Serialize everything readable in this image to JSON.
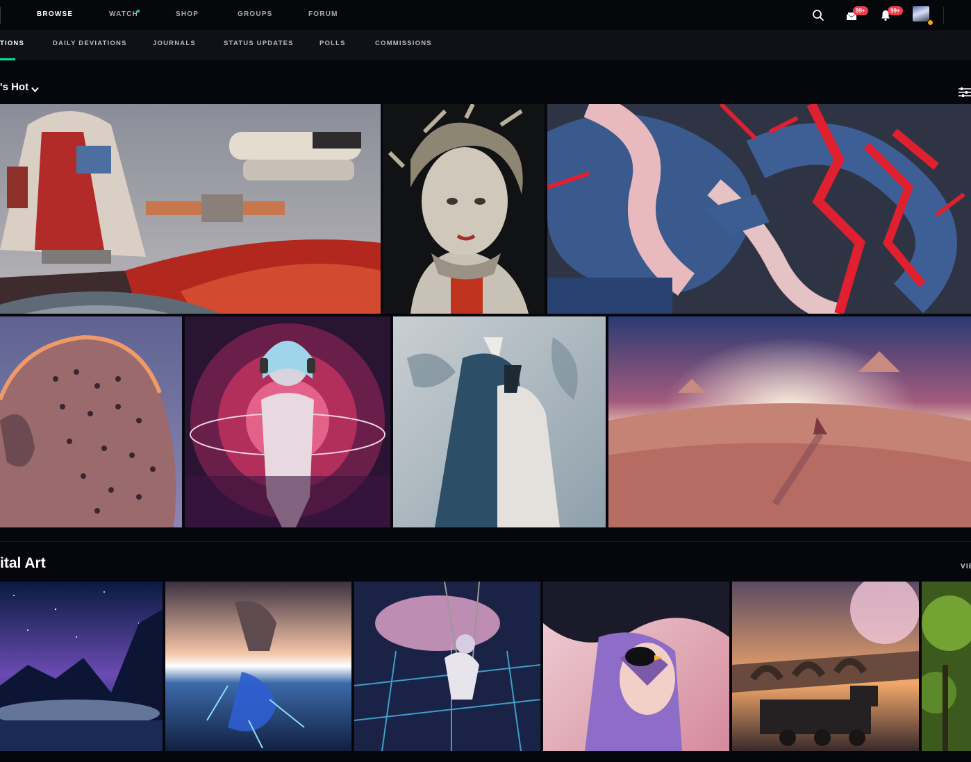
{
  "nav": {
    "items": [
      "BROWSE",
      "WATCH",
      "SHOP",
      "GROUPS",
      "FORUM"
    ],
    "active": "BROWSE",
    "watch_has_dot": true,
    "inbox_badge": "99+",
    "notifications_badge": "99+"
  },
  "subnav": {
    "items": [
      "TIONS",
      "DAILY DEVIATIONS",
      "JOURNALS",
      "STATUS UPDATES",
      "POLLS",
      "COMMISSIONS"
    ],
    "active": "TIONS"
  },
  "sections": {
    "hot_title": "'s Hot",
    "digital_title": "ital Art",
    "view_all": "VIE"
  },
  "colors": {
    "background": "#06070d",
    "accent": "#00e59b",
    "badge": "#f03c4c"
  }
}
